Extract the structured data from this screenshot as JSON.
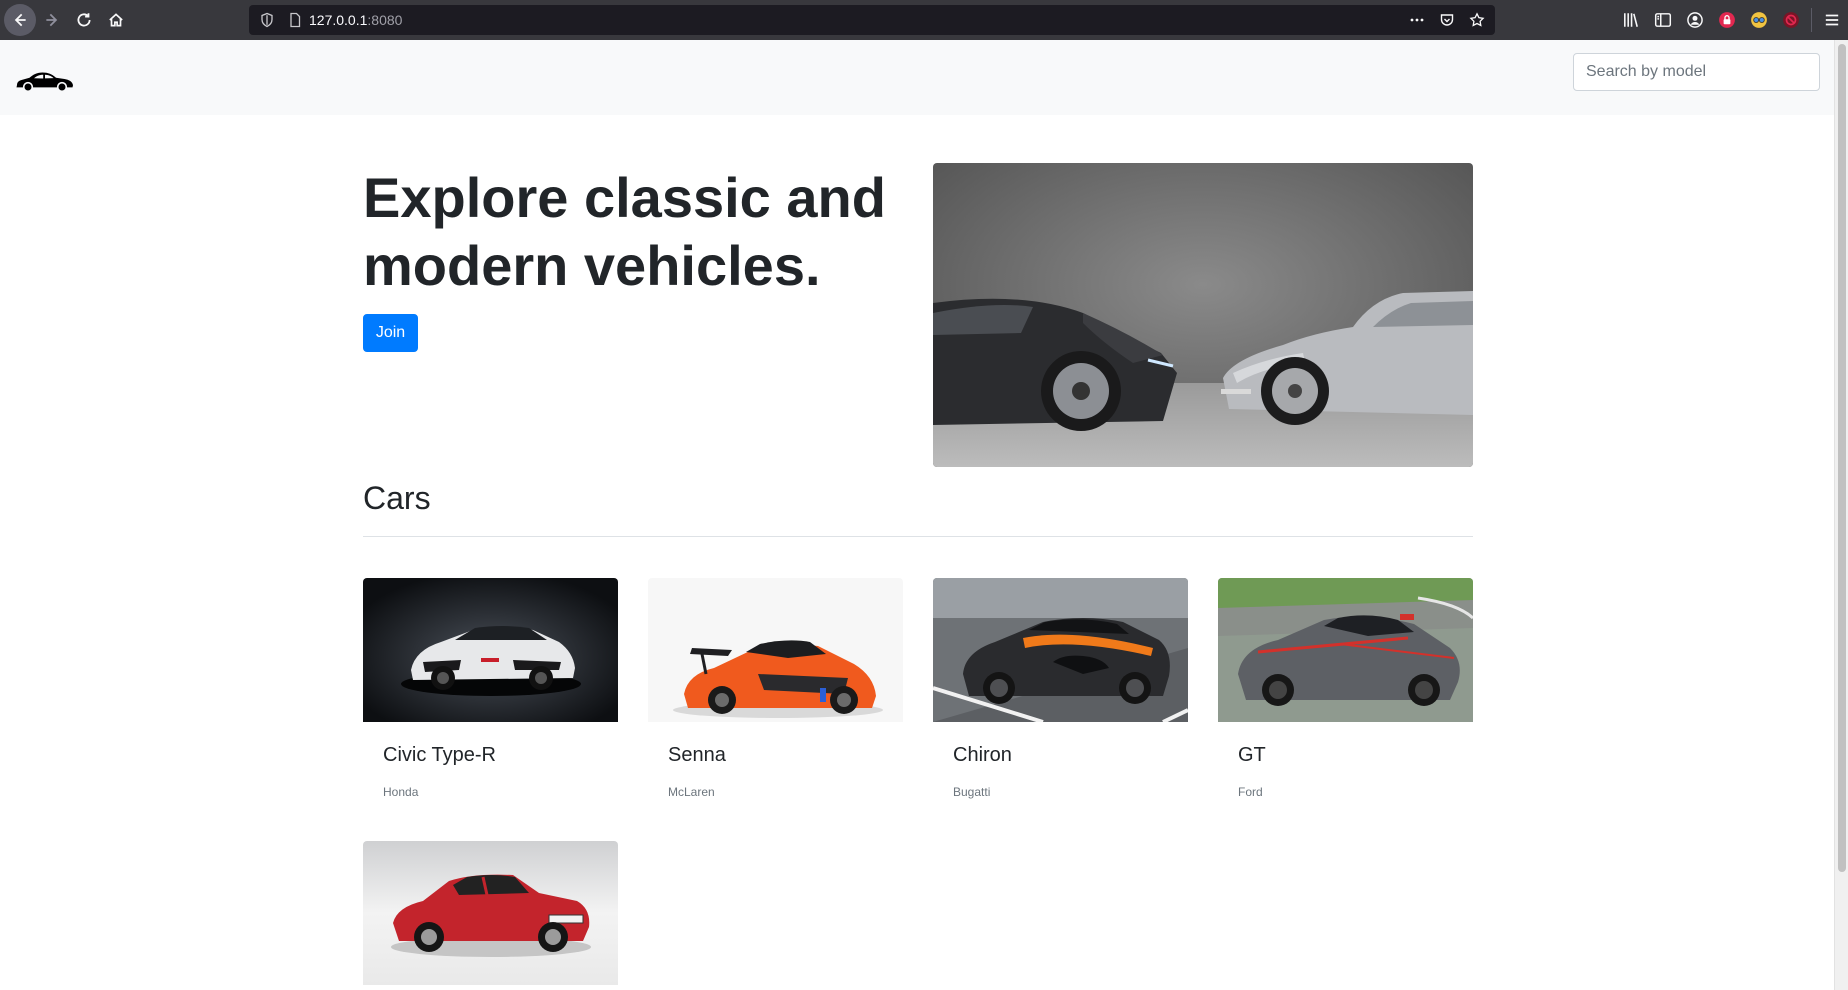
{
  "browser": {
    "url_host": "127.0.0.1",
    "url_port": ":8080"
  },
  "header": {
    "logo_icon": "car-icon",
    "search_placeholder": "Search by model"
  },
  "hero": {
    "title": "Explore classic and modern vehicles.",
    "join_label": "Join"
  },
  "cars_section": {
    "title": "Cars",
    "cars": [
      {
        "model": "Civic Type-R",
        "make": "Honda"
      },
      {
        "model": "Senna",
        "make": "McLaren"
      },
      {
        "model": "Chiron",
        "make": "Bugatti"
      },
      {
        "model": "GT",
        "make": "Ford"
      },
      {
        "model": "",
        "make": ""
      }
    ]
  },
  "colors": {
    "primary": "#007bff",
    "navbar_bg": "#f8f9fa",
    "text": "#212529",
    "muted": "#6c757d"
  }
}
